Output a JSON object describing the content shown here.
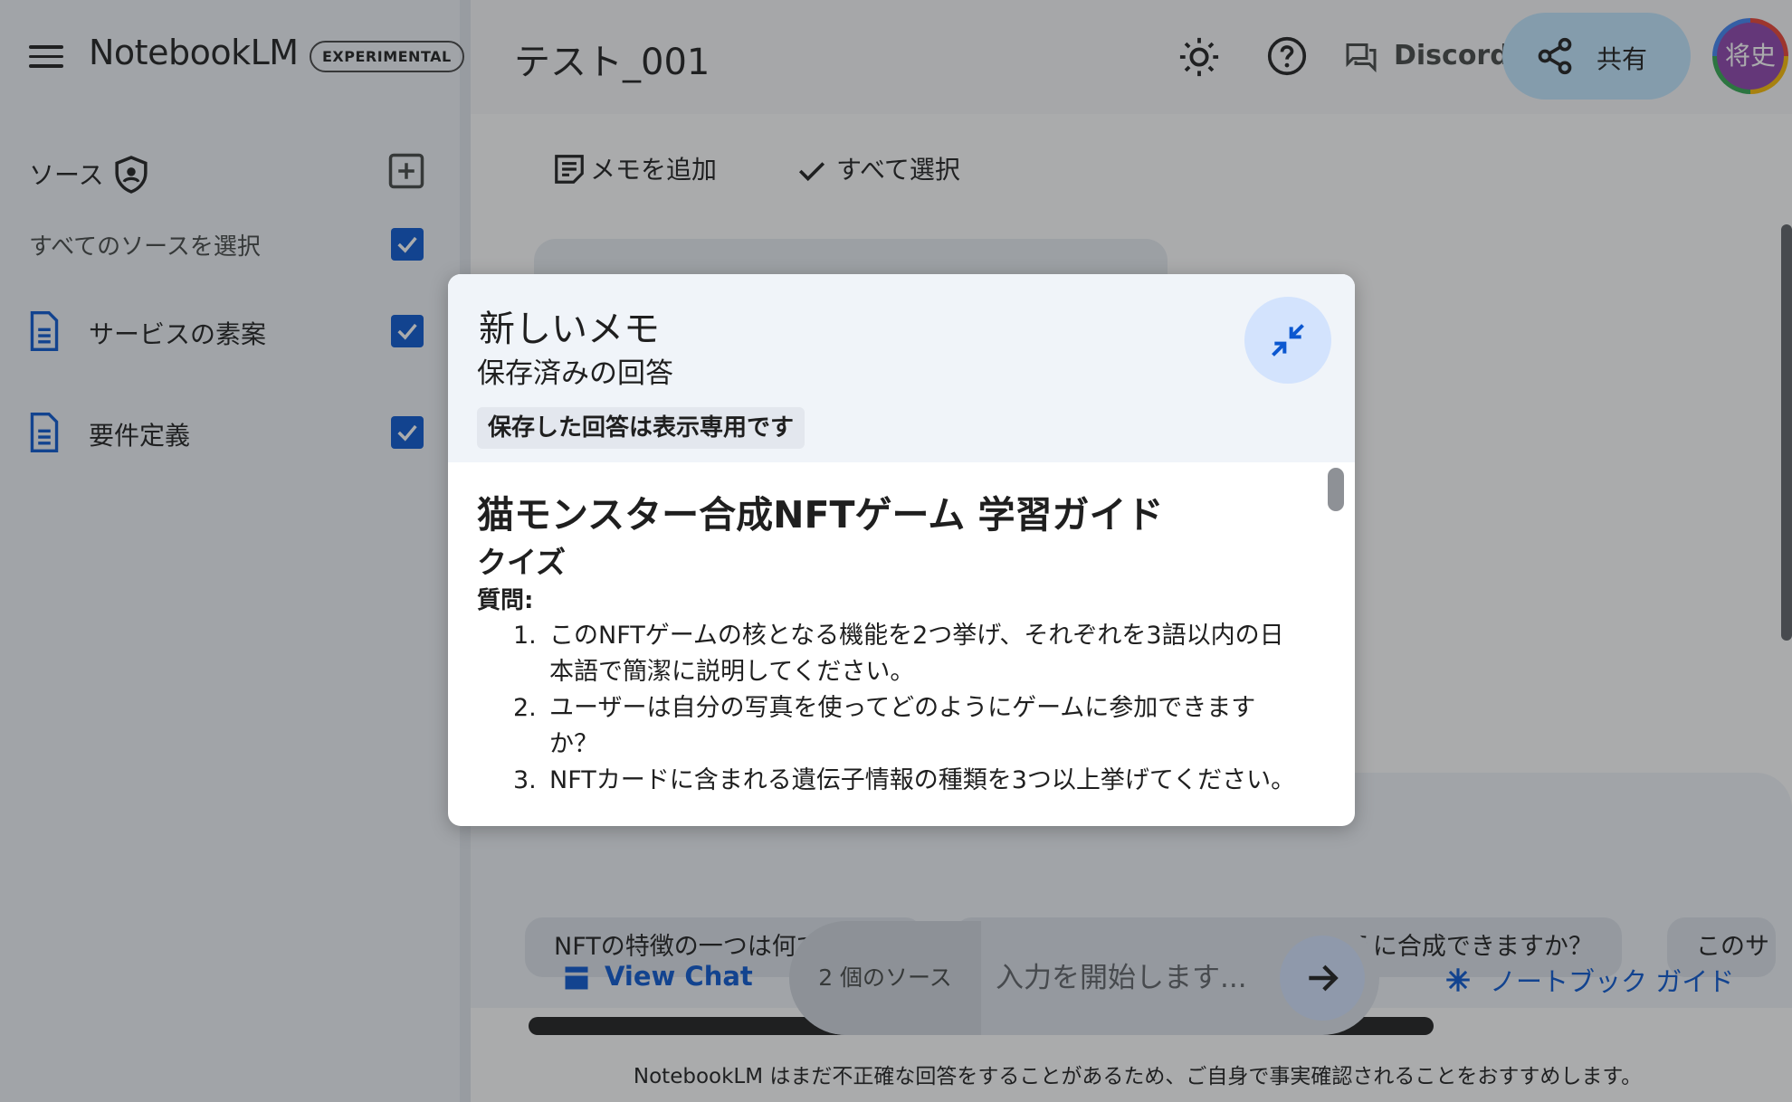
{
  "app": {
    "brand": "NotebookLM",
    "badge": "EXPERIMENTAL"
  },
  "header": {
    "notebook_title": "テスト_001",
    "theme_icon": "sun-icon",
    "help_icon": "help-circle-icon",
    "discord_label": "Discord",
    "share_label": "共有",
    "avatar_text": "将史"
  },
  "sidebar": {
    "sources_title": "ソース",
    "select_all_label": "すべてのソースを選択",
    "items": [
      {
        "label": "サービスの素案",
        "checked": true
      },
      {
        "label": "要件定義",
        "checked": true
      }
    ]
  },
  "main": {
    "toolbar": {
      "add_note": "メモを追加",
      "select_all": "すべて選択"
    },
    "suggestion_chips": [
      "NFTの特徴の一つは何ですか？",
      "ユーザーは猫モンスターをどのように合成できますか？",
      "このサ"
    ],
    "view_chat": "View Chat",
    "source_count": "2 個のソース",
    "input_placeholder": "入力を開始します...",
    "notebook_guide": "ノートブック ガイド",
    "disclaimer": "NotebookLM はまだ不正確な回答をすることがあるため、ご自身で事実確認されることをおすすめします。"
  },
  "modal": {
    "title": "新しいメモ",
    "subtitle": "保存済みの回答",
    "readonly_notice": "保存した回答は表示専用です",
    "guide_title": "猫モンスター合成NFTゲーム 学習ガイド",
    "section_title": "クイズ",
    "questions_label": "質問:",
    "questions": [
      {
        "num": "1.",
        "text": "このNFTゲームの核となる機能を2つ挙げ、それぞれを3語以内の日本語で簡潔に説明してください。"
      },
      {
        "num": "2.",
        "text": "ユーザーは自分の写真を使ってどのようにゲームに参加できますか？"
      },
      {
        "num": "3.",
        "text": "NFTカードに含まれる遺伝子情報の種類を3つ以上挙げてください。"
      }
    ]
  },
  "colors": {
    "accent": "#0b57d0",
    "share_bg": "#c2e7ff",
    "checkbox": "#0b57d0"
  }
}
